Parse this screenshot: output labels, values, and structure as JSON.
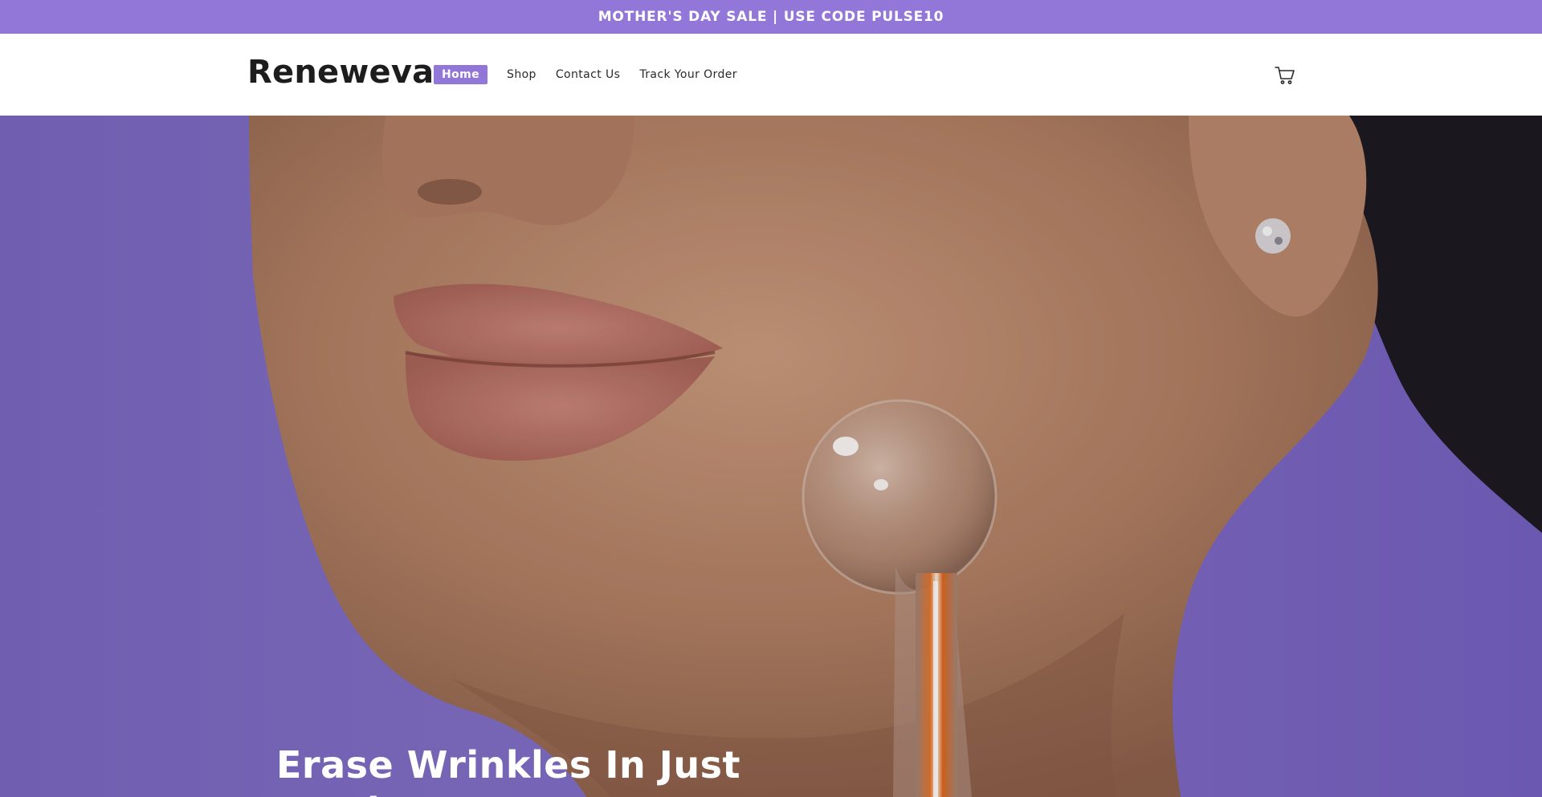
{
  "announcement": {
    "text": "MOTHER'S DAY SALE | USE CODE PULSE10"
  },
  "header": {
    "logo": "Reneweva",
    "nav": [
      {
        "label": "Home",
        "active": true
      },
      {
        "label": "Shop",
        "active": false
      },
      {
        "label": "Contact Us",
        "active": false
      },
      {
        "label": "Track Your Order",
        "active": false
      }
    ],
    "cart_icon": "cart-icon"
  },
  "hero": {
    "heading": "Erase Wrinkles In Just Weeks!",
    "image": "woman-face-high-frequency-wand-photo"
  },
  "colors": {
    "accent": "#9377d8",
    "hero_bg": "#7e6bc6",
    "text_dark": "#1d1d1d",
    "white": "#ffffff"
  }
}
